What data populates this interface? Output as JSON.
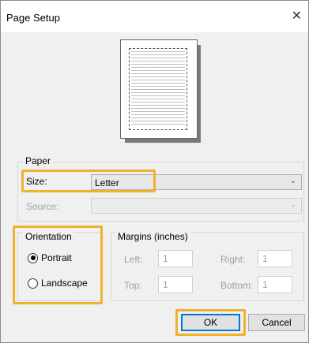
{
  "window": {
    "title": "Page Setup",
    "close_glyph": "✕"
  },
  "paper": {
    "group_label": "Paper",
    "size_label": "Size:",
    "size_value": "Letter",
    "source_label": "Source:",
    "source_value": ""
  },
  "orientation": {
    "group_label": "Orientation",
    "options": [
      {
        "label": "Portrait",
        "selected": true
      },
      {
        "label": "Landscape",
        "selected": false
      }
    ]
  },
  "margins": {
    "group_label": "Margins (inches)",
    "left_label": "Left:",
    "left_value": "1",
    "right_label": "Right:",
    "right_value": "1",
    "top_label": "Top:",
    "top_value": "1",
    "bottom_label": "Bottom:",
    "bottom_value": "1"
  },
  "buttons": {
    "ok": "OK",
    "cancel": "Cancel"
  },
  "icons": {
    "dropdown": "chevron-down-icon"
  },
  "colors": {
    "highlight": "#f0b12f",
    "accent": "#0078d7"
  }
}
